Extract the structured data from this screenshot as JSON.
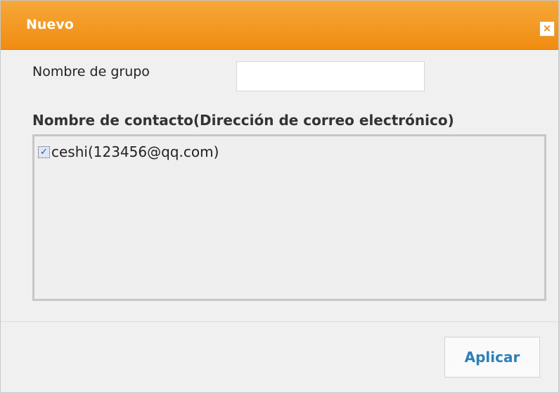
{
  "dialog": {
    "title": "Nuevo",
    "close_icon": "close-icon",
    "close_glyph": "×"
  },
  "form": {
    "group_name_label": "Nombre de grupo",
    "group_name_value": "",
    "contact_label": "Nombre de contacto(Dirección de correo electrónico)"
  },
  "contacts": [
    {
      "text": "ceshi(123456@qq.com)",
      "checked": true,
      "check_glyph": "✓"
    }
  ],
  "actions": {
    "apply_label": "Aplicar"
  },
  "colors": {
    "title_bar": "#f08c10",
    "button_text": "#2c7fb8"
  }
}
